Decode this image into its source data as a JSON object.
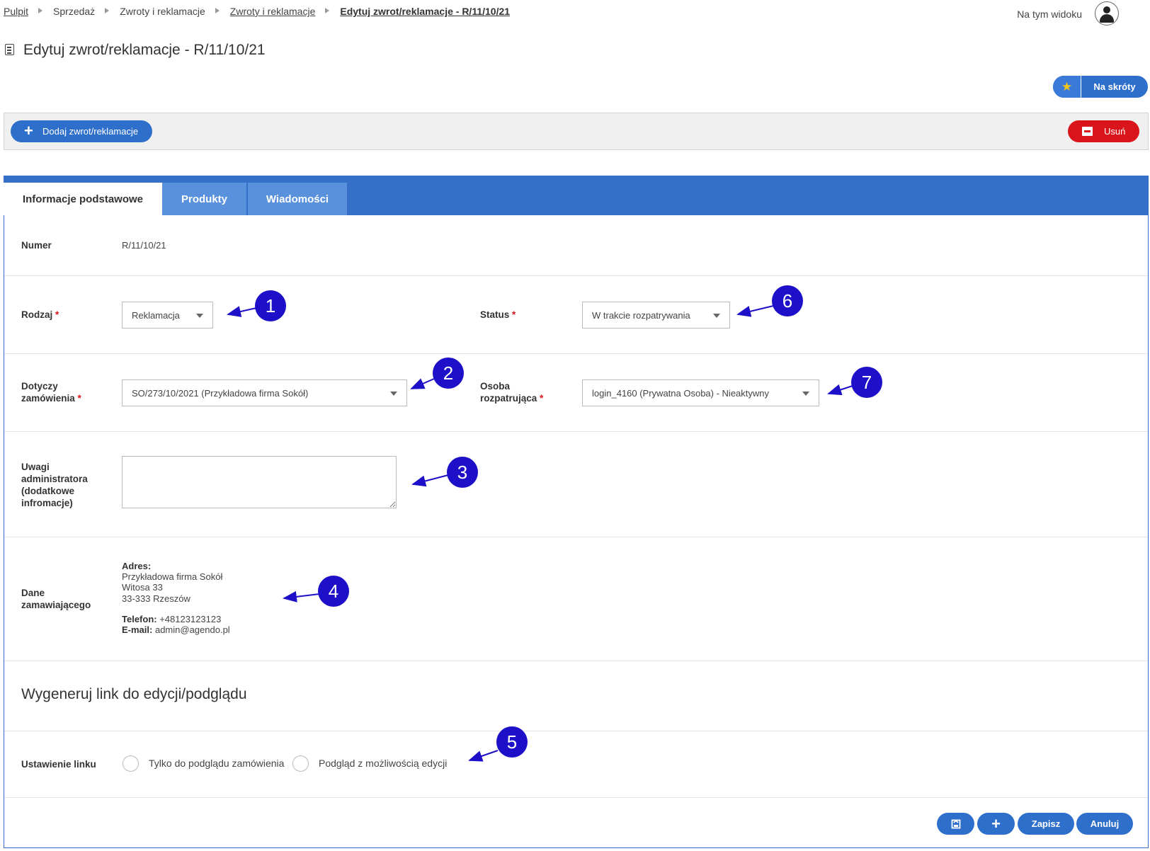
{
  "breadcrumb": {
    "items": [
      "Pulpit",
      "Sprzedaż",
      "Zwroty i reklamacje",
      "Zwroty i reklamacje",
      "Edytuj zwrot/reklamacje - R/11/10/21"
    ]
  },
  "header": {
    "view_label": "Na tym widoku",
    "page_title": "Edytuj zwrot/reklamacje - R/11/10/21",
    "shortcuts_label": "Na skróty",
    "shortcuts_icon": "star-icon"
  },
  "toolbar": {
    "add_label": "Dodaj zwrot/reklamacje",
    "delete_label": "Usuń"
  },
  "tabs": [
    "Informacje podstawowe",
    "Produkty",
    "Wiadomości"
  ],
  "form": {
    "numer_label": "Numer",
    "numer_value": "R/11/10/21",
    "rodzaj_label": "Rodzaj",
    "rodzaj_value": "Reklamacja",
    "status_label": "Status",
    "status_value": "W trakcie rozpatrywania",
    "dotyczy_label_1": "Dotyczy",
    "dotyczy_label_2": "zamówienia",
    "dotyczy_value": "SO/273/10/2021 (Przykładowa firma Sokół)",
    "osoba_label_1": "Osoba",
    "osoba_label_2": "rozpatrująca",
    "osoba_value": "login_4160 (Prywatna Osoba) - Nieaktywny",
    "uwagi_label": [
      "Uwagi",
      "administratora",
      "(dodatkowe",
      "infromacje)"
    ],
    "uwagi_value": "",
    "dane_label_1": "Dane",
    "dane_label_2": "zamawiającego",
    "required_mark": "*"
  },
  "customer": {
    "address_label": "Adres:",
    "name": "Przykładowa firma Sokół",
    "street": "Witosa 33",
    "city": "33-333 Rzeszów",
    "phone_label": "Telefon:",
    "phone": "+48123123123",
    "email_label": "E-mail:",
    "email": "admin@agendo.pl"
  },
  "link_section": {
    "title": "Wygeneruj link do edycji/podglądu",
    "setting_label": "Ustawienie linku",
    "option_1": "Tylko do podglądu zamówienia",
    "option_2": "Podgląd z możliwością edycji"
  },
  "footer": {
    "save_label": "Zapisz",
    "cancel_label": "Anuluj",
    "save_exit_icon": "save-exit-icon",
    "save_new_icon": "plus-icon"
  },
  "markers": [
    "1",
    "2",
    "3",
    "4",
    "5",
    "6",
    "7"
  ],
  "colors": {
    "primary": "#3570c8",
    "danger": "#d9151b",
    "marker": "#1d10c8"
  }
}
